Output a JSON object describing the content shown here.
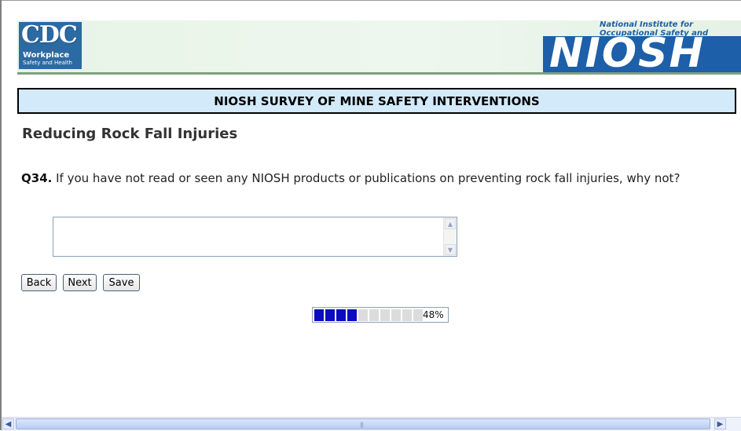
{
  "header": {
    "cdc_letters": "CDC",
    "cdc_sub1": "Workplace",
    "cdc_sub2": "Safety and Health",
    "niosh_tagline_1": "National Institute for",
    "niosh_tagline_2": "Occupational Safety and Health",
    "niosh_word": "NIOSH"
  },
  "survey_title": "NIOSH SURVEY OF MINE SAFETY INTERVENTIONS",
  "section_heading": "Reducing Rock Fall Injuries",
  "question": {
    "number": "Q34.",
    "text": " If you have not read or seen any NIOSH products or publications on preventing rock fall injuries, why not?"
  },
  "answer": {
    "value": "",
    "placeholder": ""
  },
  "buttons": {
    "back": "Back",
    "next": "Next",
    "save": "Save"
  },
  "progress": {
    "percent_label": "48%",
    "filled_segments": 4,
    "total_segments": 10,
    "filled_color": "#0b0bc0",
    "empty_color": "#dcdcdc"
  },
  "colors": {
    "title_bar_bg": "#d2eafa",
    "niosh_blue": "#1d5fa8",
    "cdc_blue": "#2b6aa3"
  }
}
